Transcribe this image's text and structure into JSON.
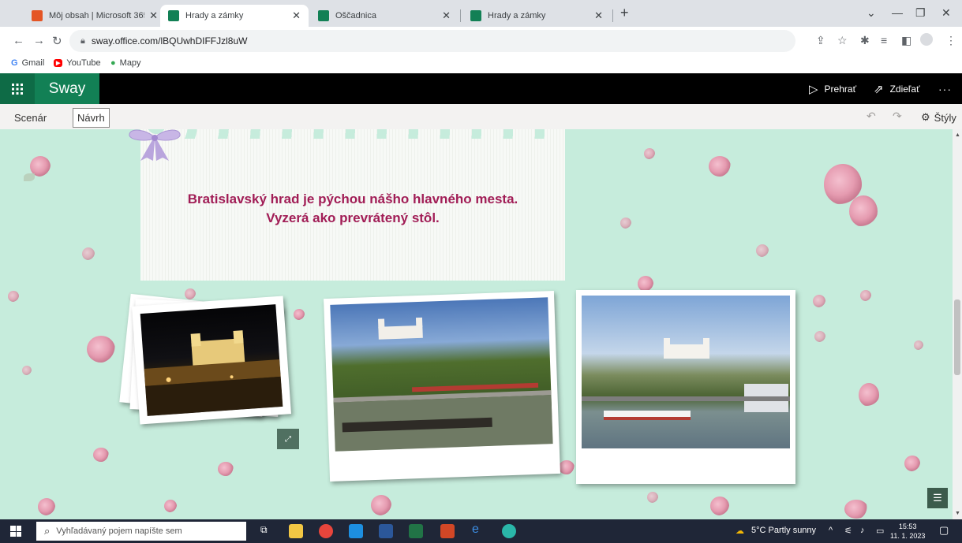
{
  "browser": {
    "tabs": [
      {
        "title": "Môj obsah | Microsoft 365",
        "active": false,
        "favicon_color": "#e45525"
      },
      {
        "title": "Hrady a zámky",
        "active": true,
        "favicon_color": "#128055"
      },
      {
        "title": "Oščadnica",
        "active": false,
        "favicon_color": "#128055"
      },
      {
        "title": "Hrady a zámky",
        "active": false,
        "favicon_color": "#128055"
      }
    ],
    "new_tab_symbol": "+",
    "close_symbol": "✕",
    "url": "sway.office.com/lBQUwhDIFFJzl8uW",
    "bookmarks": [
      {
        "label": "Gmail",
        "icon": "google-icon"
      },
      {
        "label": "YouTube",
        "icon": "youtube-icon"
      },
      {
        "label": "Mapy",
        "icon": "maps-pin-icon"
      }
    ]
  },
  "sway": {
    "brand": "Sway",
    "header_actions": [
      {
        "label": "Prehrať",
        "icon": "play-icon"
      },
      {
        "label": "Zdieľať",
        "icon": "share-icon"
      }
    ],
    "more_symbol": "···",
    "tabs": [
      {
        "label": "Scenár",
        "active": false
      },
      {
        "label": "Návrh",
        "active": true
      }
    ],
    "styles_label": "Štýly",
    "accent_color": "#128055",
    "background_color": "#c6ecdc",
    "caption_color": "#a11d56"
  },
  "content": {
    "caption_line1": "Bratislavský hrad je pýchou nášho hlavného mesta.",
    "caption_line2": "Vyzerá ako prevrátený stôl.",
    "photos": [
      {
        "subject": "Bratislava castle at night",
        "stack": true
      },
      {
        "subject": "Bratislava castle above the Danube embankment",
        "stack": false
      },
      {
        "subject": "Bratislava castle with the river and bridge",
        "stack": false
      }
    ]
  },
  "taskbar": {
    "search_placeholder": "Vyhľadávaný pojem napíšte sem",
    "weather": "5°C  Partly sunny",
    "time": "15:53",
    "date": "11. 1. 2023"
  }
}
